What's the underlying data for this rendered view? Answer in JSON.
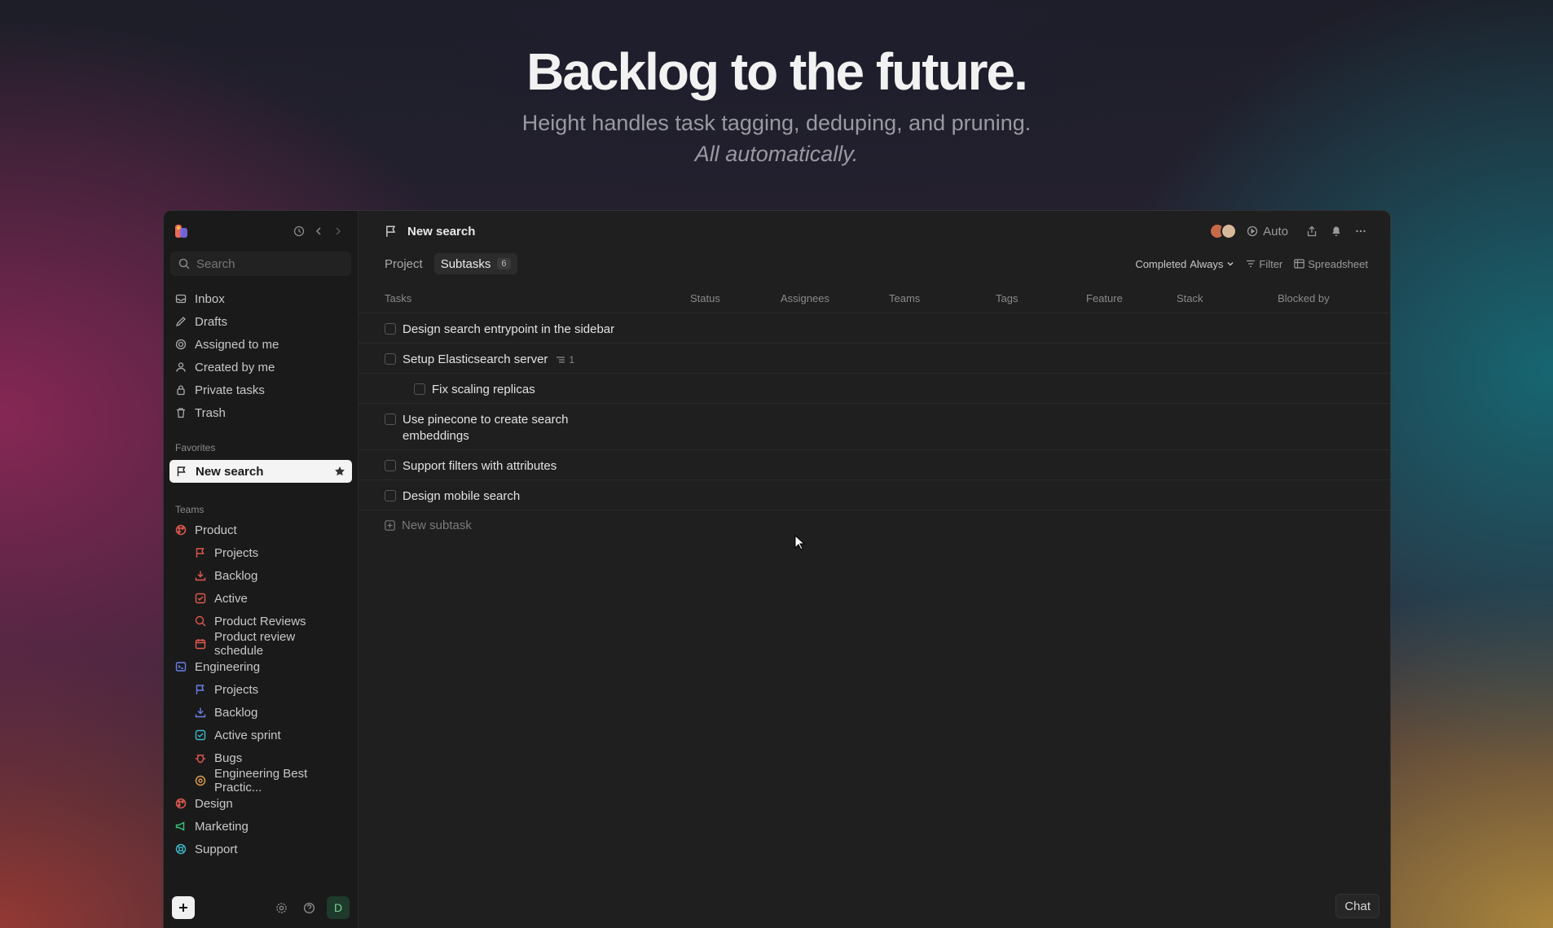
{
  "hero": {
    "title": "Backlog to the future.",
    "subtitle": "Height handles task tagging, deduping, and pruning.",
    "subtitle_italic": "All automatically."
  },
  "sidebar": {
    "search_placeholder": "Search",
    "nav": [
      {
        "label": "Inbox",
        "icon": "inbox-icon"
      },
      {
        "label": "Drafts",
        "icon": "pencil-icon"
      },
      {
        "label": "Assigned to me",
        "icon": "target-icon"
      },
      {
        "label": "Created by me",
        "icon": "user-icon"
      },
      {
        "label": "Private tasks",
        "icon": "lock-icon"
      },
      {
        "label": "Trash",
        "icon": "trash-icon"
      }
    ],
    "favorites_label": "Favorites",
    "favorite": {
      "label": "New search",
      "icon": "flag-icon"
    },
    "teams_label": "Teams",
    "teams": {
      "product": {
        "label": "Product",
        "items": [
          "Projects",
          "Backlog",
          "Active",
          "Product Reviews",
          "Product review schedule"
        ]
      },
      "engineering": {
        "label": "Engineering",
        "items": [
          "Projects",
          "Backlog",
          "Active sprint",
          "Bugs",
          "Engineering Best Practic..."
        ]
      },
      "design": {
        "label": "Design"
      },
      "marketing": {
        "label": "Marketing"
      },
      "support": {
        "label": "Support"
      }
    },
    "user_initial": "D"
  },
  "main": {
    "title": "New search",
    "auto_label": "Auto",
    "tabs": [
      {
        "label": "Project"
      },
      {
        "label": "Subtasks",
        "count": "6"
      }
    ],
    "completed_label": "Completed",
    "completed_value": "Always",
    "filter_label": "Filter",
    "view_label": "Spreadsheet",
    "columns": [
      "Tasks",
      "Status",
      "Assignees",
      "Teams",
      "Tags",
      "Feature",
      "Stack",
      "Blocked by"
    ],
    "tasks": [
      {
        "name": "Design search entrypoint in the sidebar"
      },
      {
        "name": "Setup Elasticsearch server",
        "subtasks": "1"
      },
      {
        "name": "Fix scaling replicas"
      },
      {
        "name": "Use pinecone to create search embeddings"
      },
      {
        "name": "Support filters with attributes"
      },
      {
        "name": "Design mobile search"
      }
    ],
    "new_subtask_label": "New subtask",
    "chat_label": "Chat"
  },
  "colors": {
    "product": "#e05a4e",
    "engineering": "#6b7fe8",
    "design": "#e05a4e",
    "marketing": "#3cc47a",
    "support": "#3fb8c9"
  }
}
